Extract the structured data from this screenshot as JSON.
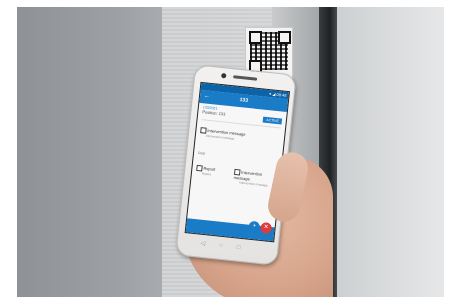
{
  "screen": {
    "status_bar": "▾ ◢ 08:48",
    "app_title": "133",
    "back_icon": "arrow-left-icon",
    "subheader": "133/2021",
    "position_label": "Position: 133",
    "chip_label": "ACTIVE",
    "options": [
      {
        "label": "Intervention message",
        "sub": "Intervention message"
      },
      {
        "label": "Report",
        "sub": "Report"
      },
      {
        "label": "Intervention message",
        "sub": "Intervention message"
      }
    ],
    "section_label": "Rest",
    "fab_add_icon": "plus-icon",
    "fab_close_icon": "close-icon"
  },
  "colors": {
    "accent": "#1a7bc6",
    "status": "#0d63a8",
    "danger": "#e03b3b"
  }
}
